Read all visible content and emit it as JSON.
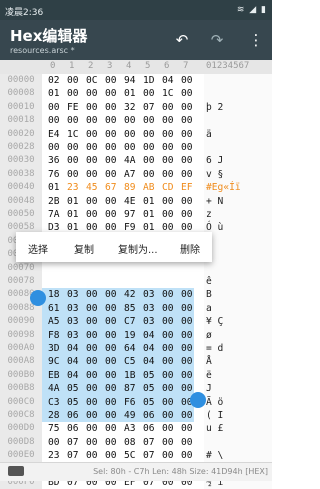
{
  "status": {
    "time": "凌晨2:36",
    "icons": "≋ ◢ ▮"
  },
  "app": {
    "title": "Hex编辑器",
    "subtitle": "resources.arsc *",
    "undo": "↶",
    "redo": "↷",
    "more": "⋮"
  },
  "header": {
    "cols": [
      "0",
      "1",
      "2",
      "3",
      "4",
      "5",
      "6",
      "7"
    ],
    "ascii": "01234567"
  },
  "rows": [
    {
      "addr": "00000",
      "cells": [
        "02",
        "00",
        "0C",
        "00",
        "94",
        "1D",
        "04",
        "00"
      ],
      "ascii": ""
    },
    {
      "addr": "00008",
      "cells": [
        "01",
        "00",
        "00",
        "00",
        "01",
        "00",
        "1C",
        "00"
      ],
      "ascii": ""
    },
    {
      "addr": "00010",
      "cells": [
        "00",
        "FE",
        "00",
        "00",
        "32",
        "07",
        "00",
        "00"
      ],
      "ascii": " þ  2"
    },
    {
      "addr": "00018",
      "cells": [
        "00",
        "00",
        "00",
        "00",
        "00",
        "00",
        "00",
        "00"
      ],
      "ascii": ""
    },
    {
      "addr": "00020",
      "cells": [
        "E4",
        "1C",
        "00",
        "00",
        "00",
        "00",
        "00",
        "00"
      ],
      "ascii": "ä"
    },
    {
      "addr": "00028",
      "cells": [
        "00",
        "00",
        "00",
        "00",
        "00",
        "00",
        "00",
        "00"
      ],
      "ascii": ""
    },
    {
      "addr": "00030",
      "cells": [
        "36",
        "00",
        "00",
        "00",
        "4A",
        "00",
        "00",
        "00"
      ],
      "ascii": "6    J"
    },
    {
      "addr": "00038",
      "cells": [
        "76",
        "00",
        "00",
        "00",
        "A7",
        "00",
        "00",
        "00"
      ],
      "ascii": "v    §"
    },
    {
      "addr": "00040",
      "cells": [
        "01",
        "23",
        "45",
        "67",
        "89",
        "AB",
        "CD",
        "EF"
      ],
      "ascii": " #Eg«Íï"
    },
    {
      "addr": "00048",
      "cells": [
        "2B",
        "01",
        "00",
        "00",
        "4E",
        "01",
        "00",
        "00"
      ],
      "ascii": "+   N"
    },
    {
      "addr": "00050",
      "cells": [
        "7A",
        "01",
        "00",
        "00",
        "97",
        "01",
        "00",
        "00"
      ],
      "ascii": "z"
    },
    {
      "addr": "00058",
      "cells": [
        "D3",
        "01",
        "00",
        "00",
        "F9",
        "01",
        "00",
        "00"
      ],
      "ascii": "Ó   ù"
    },
    {
      "addr": "00060",
      "cells": [
        "",
        "",
        "",
        "",
        "",
        "",
        "",
        ""
      ],
      "ascii": "H"
    },
    {
      "addr": "00068",
      "cells": [
        "",
        "",
        "",
        "",
        "",
        "",
        "",
        ""
      ],
      "ascii": ""
    },
    {
      "addr": "00070",
      "cells": [
        "",
        "",
        "",
        "",
        "",
        "",
        "",
        ""
      ],
      "ascii": ""
    },
    {
      "addr": "00078",
      "cells": [
        "",
        "",
        "",
        "",
        "",
        "",
        "",
        ""
      ],
      "ascii": "ê"
    },
    {
      "addr": "00080",
      "cells": [
        "18",
        "03",
        "00",
        "00",
        "42",
        "03",
        "00",
        "00"
      ],
      "ascii": "   B"
    },
    {
      "addr": "00088",
      "cells": [
        "61",
        "03",
        "00",
        "00",
        "85",
        "03",
        "00",
        "00"
      ],
      "ascii": "a"
    },
    {
      "addr": "00090",
      "cells": [
        "A5",
        "03",
        "00",
        "00",
        "C7",
        "03",
        "00",
        "00"
      ],
      "ascii": "¥   Ç"
    },
    {
      "addr": "00098",
      "cells": [
        "F8",
        "03",
        "00",
        "00",
        "19",
        "04",
        "00",
        "00"
      ],
      "ascii": "ø"
    },
    {
      "addr": "000A0",
      "cells": [
        "3D",
        "04",
        "00",
        "00",
        "64",
        "04",
        "00",
        "00"
      ],
      "ascii": "=   d"
    },
    {
      "addr": "000A8",
      "cells": [
        "9C",
        "04",
        "00",
        "00",
        "C5",
        "04",
        "00",
        "00"
      ],
      "ascii": "    Å"
    },
    {
      "addr": "000B0",
      "cells": [
        "EB",
        "04",
        "00",
        "00",
        "1B",
        "05",
        "00",
        "00"
      ],
      "ascii": "ë"
    },
    {
      "addr": "000B8",
      "cells": [
        "4A",
        "05",
        "00",
        "00",
        "87",
        "05",
        "00",
        "00"
      ],
      "ascii": "J"
    },
    {
      "addr": "000C0",
      "cells": [
        "C3",
        "05",
        "00",
        "00",
        "F6",
        "05",
        "00",
        "00"
      ],
      "ascii": "Ã   ö"
    },
    {
      "addr": "000C8",
      "cells": [
        "28",
        "06",
        "00",
        "00",
        "49",
        "06",
        "00",
        "00"
      ],
      "ascii": "(   I"
    },
    {
      "addr": "000D0",
      "cells": [
        "75",
        "06",
        "00",
        "00",
        "A3",
        "06",
        "00",
        "00"
      ],
      "ascii": "u   £"
    },
    {
      "addr": "000D8",
      "cells": [
        "00",
        "07",
        "00",
        "00",
        "08",
        "07",
        "00",
        "00"
      ],
      "ascii": ""
    },
    {
      "addr": "000E0",
      "cells": [
        "23",
        "07",
        "00",
        "00",
        "5C",
        "07",
        "00",
        "00"
      ],
      "ascii": "#   \\"
    },
    {
      "addr": "000E8",
      "cells": [
        "9B",
        "07",
        "00",
        "00",
        "CD",
        "07",
        "00",
        "00"
      ],
      "ascii": "    Í"
    },
    {
      "addr": "000F0",
      "cells": [
        "BD",
        "07",
        "00",
        "00",
        "EF",
        "07",
        "00",
        "00"
      ],
      "ascii": "½   ï"
    }
  ],
  "menu": {
    "select": "选择",
    "copy": "复制",
    "copy_as": "复制为...",
    "delete": "删除"
  },
  "bottom": {
    "info": "Sel: 80h - C7h  Len: 48h  Size: 41D94h [HEX]"
  }
}
